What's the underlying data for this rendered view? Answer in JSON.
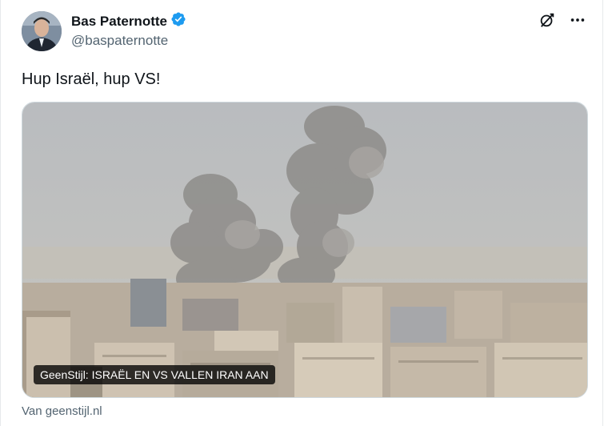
{
  "author": {
    "display_name": "Bas Paternotte",
    "handle": "@baspaternotte",
    "verified": true
  },
  "icons": {
    "verified": "verified-badge-icon",
    "grok": "grok-icon",
    "more": "more-icon"
  },
  "tweet": {
    "text": "Hup Israël, hup VS!"
  },
  "media": {
    "caption": "GeenStijl: ISRAËL EN VS VALLEN IRAN AAN",
    "source": "Van geenstijl.nl"
  },
  "colors": {
    "verified_blue": "#1d9bf0",
    "secondary_text": "#536471"
  }
}
